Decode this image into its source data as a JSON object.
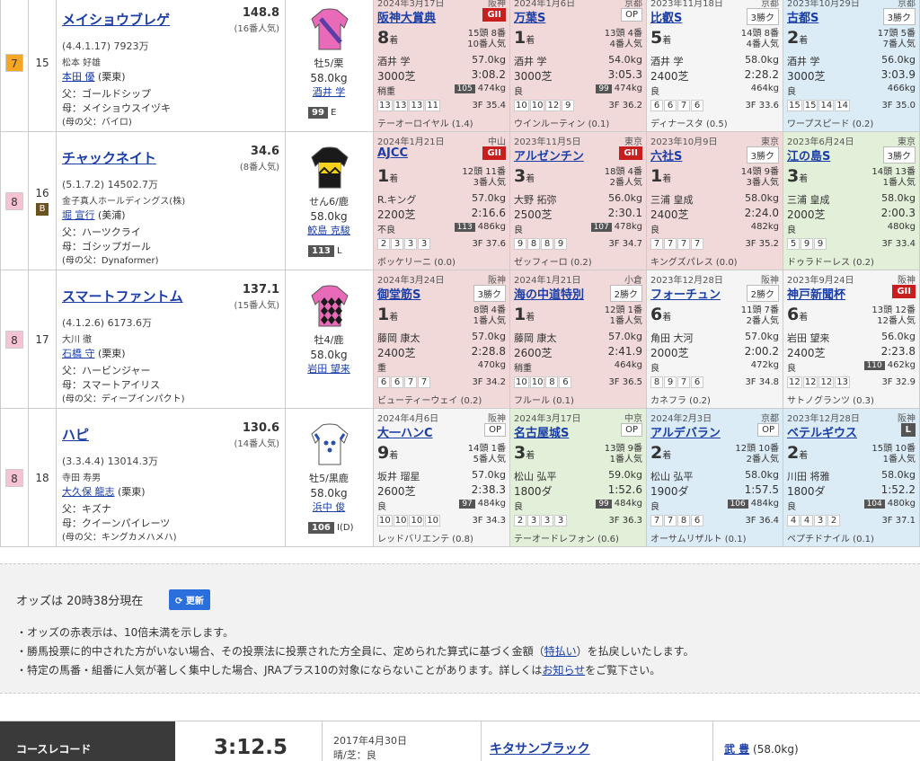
{
  "runners": [
    {
      "waku": "7",
      "waku_color": "#f5a623",
      "umaban": "15",
      "blinkers": "",
      "name": "メイショウブレゲ",
      "odds": "148.8",
      "popularity": "(16番人気)",
      "record": "(4.4.1.17)  7923万",
      "owner": "松本 好雄",
      "trainer_name": "本田 優",
      "trainer_region": "(栗東)",
      "sire": "父：ゴールドシップ",
      "dam": "母：メイショウスイヅキ",
      "bms": "(母の父：バイロ)",
      "sex_age": "牡5/栗",
      "weight": "58.0kg",
      "jockey": "酒井 学",
      "rating": "99",
      "rating_note": "E",
      "silk_main": "#e86ab8",
      "silk_accent": "#5a3ea6",
      "past": [
        {
          "bg": "c1",
          "date": "2024年3月17日",
          "venue": "阪神",
          "race": "阪神大賞典",
          "grade": "GII",
          "gcls": "g2",
          "pos": "8",
          "field1": "15頭 8番",
          "field2": "10番人気",
          "jockey": "酒井 学",
          "wt": "57.0kg",
          "dist": "3000芝",
          "time": "3:08.2",
          "cond": "稍重",
          "rate": "105",
          "bw": "474kg",
          "corners": [
            "13",
            "13",
            "13",
            "11"
          ],
          "f3": "3F 35.4",
          "winner": "テーオーロイヤル (1.4)"
        },
        {
          "bg": "c1",
          "date": "2024年1月6日",
          "venue": "京都",
          "race": "万葉S",
          "grade": "OP",
          "gcls": "",
          "pos": "1",
          "field1": "13頭 4番",
          "field2": "4番人気",
          "jockey": "酒井 学",
          "wt": "54.0kg",
          "dist": "3000芝",
          "time": "3:05.3",
          "cond": "良",
          "rate": "99",
          "bw": "474kg",
          "corners": [
            "10",
            "10",
            "12",
            "9"
          ],
          "f3": "3F 36.2",
          "winner": "ウインルーティン (0.1)"
        },
        {
          "bg": "c0",
          "date": "2023年11月18日",
          "venue": "京都",
          "race": "比叡S",
          "grade": "3勝ク",
          "gcls": "",
          "pos": "5",
          "field1": "14頭 8番",
          "field2": "4番人気",
          "jockey": "酒井 学",
          "wt": "58.0kg",
          "dist": "2400芝",
          "time": "2:28.2",
          "cond": "良",
          "rate": "",
          "bw": "464kg",
          "corners": [
            "6",
            "6",
            "7",
            "6"
          ],
          "f3": "3F 33.6",
          "winner": "ディナースタ (0.5)"
        },
        {
          "bg": "c3",
          "date": "2023年10月29日",
          "venue": "京都",
          "race": "古都S",
          "grade": "3勝ク",
          "gcls": "",
          "pos": "2",
          "field1": "17頭 5番",
          "field2": "7番人気",
          "jockey": "酒井 学",
          "wt": "56.0kg",
          "dist": "3000芝",
          "time": "3:03.9",
          "cond": "良",
          "rate": "",
          "bw": "466kg",
          "corners": [
            "15",
            "15",
            "14",
            "14"
          ],
          "f3": "3F 35.0",
          "winner": "ワープスピード (0.2)"
        }
      ]
    },
    {
      "waku": "8",
      "waku_color": "#f6c3d3",
      "umaban": "16",
      "blinkers": "B",
      "name": "チャックネイト",
      "odds": "34.6",
      "popularity": "(8番人気)",
      "record": "(5.1.7.2)  14502.7万",
      "owner": "金子真人ホールディングス(株)",
      "trainer_name": "堀 宣行",
      "trainer_region": "(美浦)",
      "sire": "父：ハーツクライ",
      "dam": "母：ゴシップガール",
      "bms": "(母の父：Dynaformer)",
      "sex_age": "せん6/鹿",
      "weight": "58.0kg",
      "jockey": "鮫島 克駿",
      "rating": "113",
      "rating_note": "L",
      "silk_main": "#1a1a1a",
      "silk_accent": "#f3d21c",
      "past": [
        {
          "bg": "c1",
          "date": "2024年1月21日",
          "venue": "中山",
          "race": "AJCC",
          "grade": "GII",
          "gcls": "g2",
          "pos": "1",
          "field1": "12頭 11番",
          "field2": "3番人気",
          "jockey": "R.キング",
          "wt": "57.0kg",
          "dist": "2200芝",
          "time": "2:16.6",
          "cond": "不良",
          "rate": "113",
          "bw": "486kg",
          "corners": [
            "2",
            "3",
            "3",
            "3"
          ],
          "f3": "3F 37.6",
          "winner": "ボッケリーニ (0.0)"
        },
        {
          "bg": "c1",
          "date": "2023年11月5日",
          "venue": "東京",
          "race": "アルゼンチン",
          "grade": "GII",
          "gcls": "g2",
          "pos": "3",
          "field1": "18頭 4番",
          "field2": "2番人気",
          "jockey": "大野 拓弥",
          "wt": "56.0kg",
          "dist": "2500芝",
          "time": "2:30.1",
          "cond": "良",
          "rate": "107",
          "bw": "478kg",
          "corners": [
            "9",
            "8",
            "8",
            "9"
          ],
          "f3": "3F 34.7",
          "winner": "ゼッフィーロ (0.2)"
        },
        {
          "bg": "c1",
          "date": "2023年10月9日",
          "venue": "東京",
          "race": "六社S",
          "grade": "3勝ク",
          "gcls": "",
          "pos": "1",
          "field1": "14頭 9番",
          "field2": "3番人気",
          "jockey": "三浦 皇成",
          "wt": "58.0kg",
          "dist": "2400芝",
          "time": "2:24.0",
          "cond": "良",
          "rate": "",
          "bw": "482kg",
          "corners": [
            "7",
            "7",
            "7",
            "7"
          ],
          "f3": "3F 35.2",
          "winner": "キングズパレス (0.0)"
        },
        {
          "bg": "c2",
          "date": "2023年6月24日",
          "venue": "東京",
          "race": "江の島S",
          "grade": "3勝ク",
          "gcls": "",
          "pos": "3",
          "field1": "14頭 13番",
          "field2": "1番人気",
          "jockey": "三浦 皇成",
          "wt": "58.0kg",
          "dist": "2000芝",
          "time": "2:00.3",
          "cond": "良",
          "rate": "",
          "bw": "480kg",
          "corners": [
            "5",
            "9",
            "9"
          ],
          "f3": "3F 33.4",
          "winner": "ドゥラドーレス (0.2)"
        }
      ]
    },
    {
      "waku": "8",
      "waku_color": "#f6c3d3",
      "umaban": "17",
      "blinkers": "",
      "name": "スマートファントム",
      "odds": "137.1",
      "popularity": "(15番人気)",
      "record": "(4.1.2.6)  6173.6万",
      "owner": "大川 徹",
      "trainer_name": "石橋 守",
      "trainer_region": "(栗東)",
      "sire": "父：ハービンジャー",
      "dam": "母：スマートアイリス",
      "bms": "(母の父：ディープインパクト)",
      "sex_age": "牡4/鹿",
      "weight": "58.0kg",
      "jockey": "岩田 望来",
      "rating": "",
      "rating_note": "",
      "silk_main": "#e86ab8",
      "silk_accent": "#1a1a1a",
      "past": [
        {
          "bg": "c1",
          "date": "2024年3月24日",
          "venue": "阪神",
          "race": "御堂筋S",
          "grade": "3勝ク",
          "gcls": "",
          "pos": "1",
          "field1": "8頭 4番",
          "field2": "1番人気",
          "jockey": "藤岡 康太",
          "wt": "57.0kg",
          "dist": "2400芝",
          "time": "2:28.8",
          "cond": "重",
          "rate": "",
          "bw": "470kg",
          "corners": [
            "6",
            "6",
            "7",
            "7"
          ],
          "f3": "3F 34.2",
          "winner": "ビューティーウェイ (0.2)"
        },
        {
          "bg": "c1",
          "date": "2024年1月21日",
          "venue": "小倉",
          "race": "海の中道特別",
          "grade": "2勝ク",
          "gcls": "",
          "pos": "1",
          "field1": "12頭 1番",
          "field2": "1番人気",
          "jockey": "藤岡 康太",
          "wt": "57.0kg",
          "dist": "2600芝",
          "time": "2:41.9",
          "cond": "稍重",
          "rate": "",
          "bw": "464kg",
          "corners": [
            "10",
            "10",
            "8",
            "6"
          ],
          "f3": "3F 36.5",
          "winner": "フルール (0.1)"
        },
        {
          "bg": "c0",
          "date": "2023年12月28日",
          "venue": "阪神",
          "race": "フォーチュン",
          "grade": "2勝ク",
          "gcls": "",
          "pos": "6",
          "field1": "11頭 7番",
          "field2": "2番人気",
          "jockey": "角田 大河",
          "wt": "57.0kg",
          "dist": "2000芝",
          "time": "2:00.2",
          "cond": "良",
          "rate": "",
          "bw": "472kg",
          "corners": [
            "8",
            "9",
            "7",
            "6"
          ],
          "f3": "3F 34.8",
          "winner": "カネフラ (0.2)"
        },
        {
          "bg": "c0",
          "date": "2023年9月24日",
          "venue": "阪神",
          "race": "神戸新聞杯",
          "grade": "GII",
          "gcls": "g2",
          "pos": "6",
          "field1": "13頭 12番",
          "field2": "12番人気",
          "jockey": "岩田 望来",
          "wt": "56.0kg",
          "dist": "2400芝",
          "time": "2:23.8",
          "cond": "良",
          "rate": "110",
          "bw": "462kg",
          "corners": [
            "12",
            "12",
            "12",
            "13"
          ],
          "f3": "3F 32.9",
          "winner": "サトノグランツ (0.3)"
        }
      ]
    },
    {
      "waku": "8",
      "waku_color": "#f6c3d3",
      "umaban": "18",
      "blinkers": "",
      "name": "ハピ",
      "odds": "130.6",
      "popularity": "(14番人気)",
      "record": "(3.3.4.4)  13014.3万",
      "owner": "寺田 寿男",
      "trainer_name": "大久保 龍志",
      "trainer_region": "(栗東)",
      "sire": "父：キズナ",
      "dam": "母：クイーンパイレーツ",
      "bms": "(母の父：キングカメハメハ)",
      "sex_age": "牡5/黒鹿",
      "weight": "58.0kg",
      "jockey": "浜中 俊",
      "rating": "106",
      "rating_note": "I(D)",
      "silk_main": "#ffffff",
      "silk_accent": "#2a4fb0",
      "past": [
        {
          "bg": "c0",
          "date": "2024年4月6日",
          "venue": "阪神",
          "race": "大一ハンC",
          "grade": "OP",
          "gcls": "",
          "pos": "9",
          "field1": "14頭 1番",
          "field2": "5番人気",
          "jockey": "坂井 瑠星",
          "wt": "57.0kg",
          "dist": "2600芝",
          "time": "2:38.3",
          "cond": "良",
          "rate": "97",
          "bw": "484kg",
          "corners": [
            "10",
            "10",
            "10",
            "10"
          ],
          "f3": "3F 34.3",
          "winner": "レッドバリエンテ (0.8)"
        },
        {
          "bg": "c2",
          "date": "2024年3月17日",
          "venue": "中京",
          "race": "名古屋城S",
          "grade": "OP",
          "gcls": "",
          "pos": "3",
          "field1": "13頭 9番",
          "field2": "1番人気",
          "jockey": "松山 弘平",
          "wt": "59.0kg",
          "dist": "1800ダ",
          "time": "1:52.6",
          "cond": "良",
          "rate": "99",
          "bw": "484kg",
          "corners": [
            "2",
            "3",
            "3",
            "3"
          ],
          "f3": "3F 36.3",
          "winner": "テーオードレフォン (0.6)"
        },
        {
          "bg": "c3",
          "date": "2024年2月3日",
          "venue": "京都",
          "race": "アルデバラン",
          "grade": "OP",
          "gcls": "",
          "pos": "2",
          "field1": "12頭 10番",
          "field2": "2番人気",
          "jockey": "松山 弘平",
          "wt": "58.0kg",
          "dist": "1900ダ",
          "time": "1:57.5",
          "cond": "良",
          "rate": "106",
          "bw": "484kg",
          "corners": [
            "7",
            "7",
            "8",
            "6"
          ],
          "f3": "3F 36.4",
          "winner": "オーサムリザルト (0.1)"
        },
        {
          "bg": "c3",
          "date": "2023年12月28日",
          "venue": "阪神",
          "race": "ベテルギウス",
          "grade": "L",
          "gcls": "gl",
          "pos": "2",
          "field1": "15頭 10番",
          "field2": "1番人気",
          "jockey": "川田 将雅",
          "wt": "58.0kg",
          "dist": "1800ダ",
          "time": "1:52.2",
          "cond": "良",
          "rate": "104",
          "bw": "480kg",
          "corners": [
            "4",
            "4",
            "3",
            "2"
          ],
          "f3": "3F 37.1",
          "winner": "ペプチドナイル (0.1)"
        }
      ]
    }
  ],
  "odds_section": {
    "status": "オッズは 20時38分現在",
    "update_button": "更新",
    "note1": "・オッズの赤表示は、10倍未満を示します。",
    "note2_a": "・勝馬投票に的中された方がいない場合、その投票法に投票された方全員に、定められた算式に基づく金額（",
    "note2_link": "特払い",
    "note2_b": "）を払戻しいたします。",
    "note3_a": "・特定の馬番・組番に人気が著しく集中した場合、JRAプラス10の対象にならないことがあります。詳しくは",
    "note3_link": "お知らせ",
    "note3_b": "をご覧下さい。"
  },
  "course_record": {
    "label": "コースレコード",
    "time": "3:12.5",
    "date": "2017年4月30日",
    "cond": "晴/芝：良",
    "horse": "キタサンブラック",
    "jockey": "武 豊",
    "jockey_weight": "(58.0kg)"
  },
  "pos_suffix": "着"
}
